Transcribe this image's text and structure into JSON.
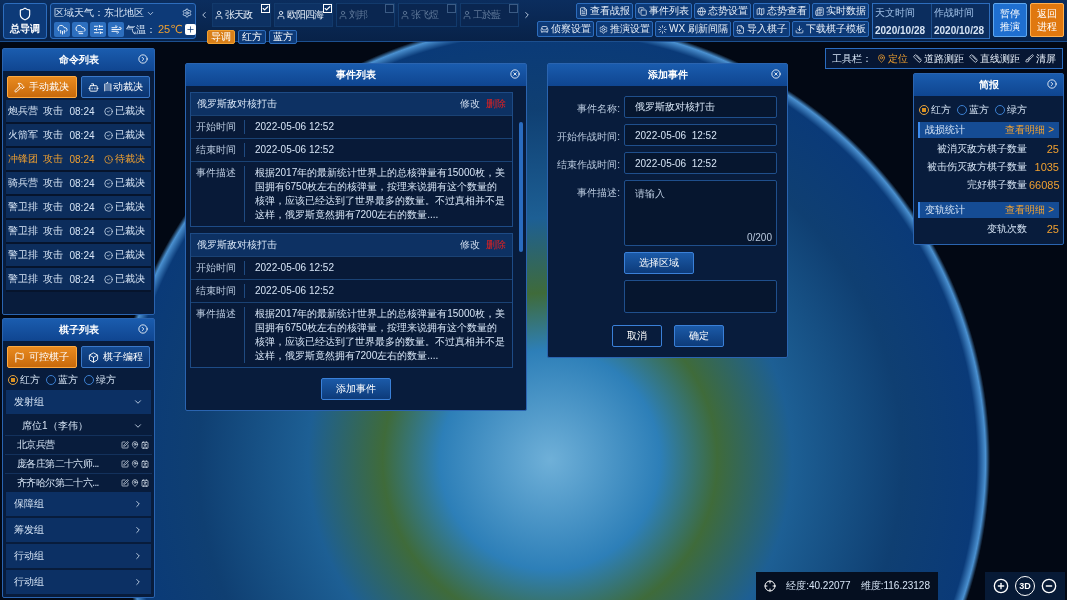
{
  "top_bar": {
    "logo": {
      "label": "总导调"
    },
    "weather": {
      "region": "区域天气：东北地区",
      "temperature_label": "气温：",
      "temperature": "25℃"
    },
    "players": [
      {
        "name": "张天政",
        "checked": true
      },
      {
        "name": "欧阳四海",
        "checked": true
      },
      {
        "name": "刘邦",
        "checked": false
      },
      {
        "name": "张飞煜",
        "checked": false
      },
      {
        "name": "工於藍",
        "checked": false
      }
    ],
    "sides": [
      {
        "label": "导调",
        "selected": true
      },
      {
        "label": "红方",
        "selected": false
      },
      {
        "label": "蓝方",
        "selected": false
      }
    ],
    "actions": [
      [
        "查看战报",
        "事件列表",
        "态势设置",
        "态势查看",
        "实时数据"
      ],
      [
        "侦察设置",
        "推演设置",
        "WX 刷新间隔",
        "导入棋子",
        "下载棋子模板"
      ]
    ],
    "clock": [
      {
        "label": "天文时间",
        "value": "2020/10/28"
      },
      {
        "label": "作战时间",
        "value": "2020/10/28"
      }
    ],
    "big_buttons": [
      {
        "label": "暂停推演",
        "kind": "primary"
      },
      {
        "label": "返回进程",
        "kind": "warning"
      }
    ]
  },
  "toolbar": {
    "label": "工具栏：",
    "tools": [
      {
        "label": "定位",
        "selected": true
      },
      {
        "label": "道路测距",
        "selected": false
      },
      {
        "label": "直线测距",
        "selected": false
      },
      {
        "label": "清屏",
        "selected": false
      }
    ]
  },
  "command_list": {
    "title": "命令列表",
    "modes": [
      {
        "label": "手动裁决",
        "selected": true
      },
      {
        "label": "自动裁决",
        "selected": false
      }
    ],
    "rows": [
      {
        "unit": "炮兵营",
        "action": "攻击",
        "time": "08:24",
        "status": "已裁决",
        "pending": false
      },
      {
        "unit": "火箭军",
        "action": "攻击",
        "time": "08:24",
        "status": "已裁决",
        "pending": false
      },
      {
        "unit": "冲锋团",
        "action": "攻击",
        "time": "08:24",
        "status": "待裁决",
        "pending": true
      },
      {
        "unit": "骑兵营",
        "action": "攻击",
        "time": "08:24",
        "status": "已裁决",
        "pending": false
      },
      {
        "unit": "警卫排",
        "action": "攻击",
        "time": "08:24",
        "status": "已裁决",
        "pending": false
      },
      {
        "unit": "警卫排",
        "action": "攻击",
        "time": "08:24",
        "status": "已裁决",
        "pending": false
      },
      {
        "unit": "警卫排",
        "action": "攻击",
        "time": "08:24",
        "status": "已裁决",
        "pending": false
      },
      {
        "unit": "警卫排",
        "action": "攻击",
        "time": "08:24",
        "status": "已裁决",
        "pending": false
      }
    ]
  },
  "piece_list": {
    "title": "棋子列表",
    "modes": [
      {
        "label": "可控棋子",
        "selected": true
      },
      {
        "label": "棋子编程",
        "selected": false
      }
    ],
    "sides": [
      {
        "label": "红方",
        "selected": true
      },
      {
        "label": "蓝方",
        "selected": false
      },
      {
        "label": "绿方",
        "selected": false
      }
    ],
    "groups": [
      {
        "label": "发射组",
        "expanded": true,
        "children": [
          {
            "label": "席位1（李伟）",
            "expanded": true,
            "children": [
              {
                "label": "北京兵营"
              },
              {
                "label": "庞各庄第二十六师..."
              },
              {
                "label": "齐齐哈尔第二十六..."
              }
            ]
          }
        ]
      },
      {
        "label": "保障组",
        "expanded": false
      },
      {
        "label": "筹发组",
        "expanded": false
      },
      {
        "label": "行动组",
        "expanded": false
      },
      {
        "label": "行动组",
        "expanded": false
      }
    ]
  },
  "event_list": {
    "title": "事件列表",
    "events": [
      {
        "title": "俄罗斯敌对核打击",
        "edit": "修改",
        "delete": "删除",
        "rows": [
          {
            "label": "开始时间",
            "value": "2022-05-06  12:52"
          },
          {
            "label": "结束时间",
            "value": "2022-05-06  12:52"
          },
          {
            "label": "事件描述",
            "value": "根据2017年的最新统计世界上的总核弹量有15000枚，美国拥有6750枚左右的核弹量，按理来说拥有这个数量的核弹，应该已经达到了世界最多的数量。不过真相并不是这样，俄罗斯竟然拥有7200左右的数量...."
          }
        ]
      },
      {
        "title": "俄罗斯敌对核打击",
        "edit": "修改",
        "delete": "删除",
        "rows": [
          {
            "label": "开始时间",
            "value": "2022-05-06  12:52"
          },
          {
            "label": "结束时间",
            "value": "2022-05-06  12:52"
          },
          {
            "label": "事件描述",
            "value": "根据2017年的最新统计世界上的总核弹量有15000枚，美国拥有6750枚左右的核弹量，按理来说拥有这个数量的核弹，应该已经达到了世界最多的数量。不过真相并不是这样，俄罗斯竟然拥有7200左右的数量...."
          }
        ]
      }
    ],
    "add_button": "添加事件"
  },
  "add_event": {
    "title": "添加事件",
    "fields": [
      {
        "label": "事件名称:",
        "value": "俄罗斯敌对核打击"
      },
      {
        "label": "开始作战时间:",
        "value": "2022-05-06  12:52"
      },
      {
        "label": "结束作战时间:",
        "value": "2022-05-06  12:52"
      }
    ],
    "description": {
      "label": "事件描述:",
      "placeholder": "请输入",
      "counter": "0/200"
    },
    "area_button": "选择区域",
    "cancel": "取消",
    "confirm": "确定"
  },
  "brief": {
    "title": "简报",
    "sides": [
      {
        "label": "红方",
        "selected": true
      },
      {
        "label": "蓝方",
        "selected": false
      },
      {
        "label": "绿方",
        "selected": false
      }
    ],
    "sections": [
      {
        "title": "战损统计",
        "link": "查看明细 >",
        "stats": [
          {
            "label": "被消灭敌方棋子数量",
            "value": "25"
          },
          {
            "label": "被击伤灭敌方棋子数量",
            "value": "1035"
          },
          {
            "label": "完好棋子数量",
            "value": "66085"
          }
        ]
      },
      {
        "title": "变轨统计",
        "link": "查看明细 >",
        "stats": [
          {
            "label": "变轨次数",
            "value": "25"
          }
        ]
      }
    ]
  },
  "status_bar": {
    "longitude": "经度:40.22077",
    "latitude": "维度:116.23128",
    "map_controls": "3D"
  }
}
